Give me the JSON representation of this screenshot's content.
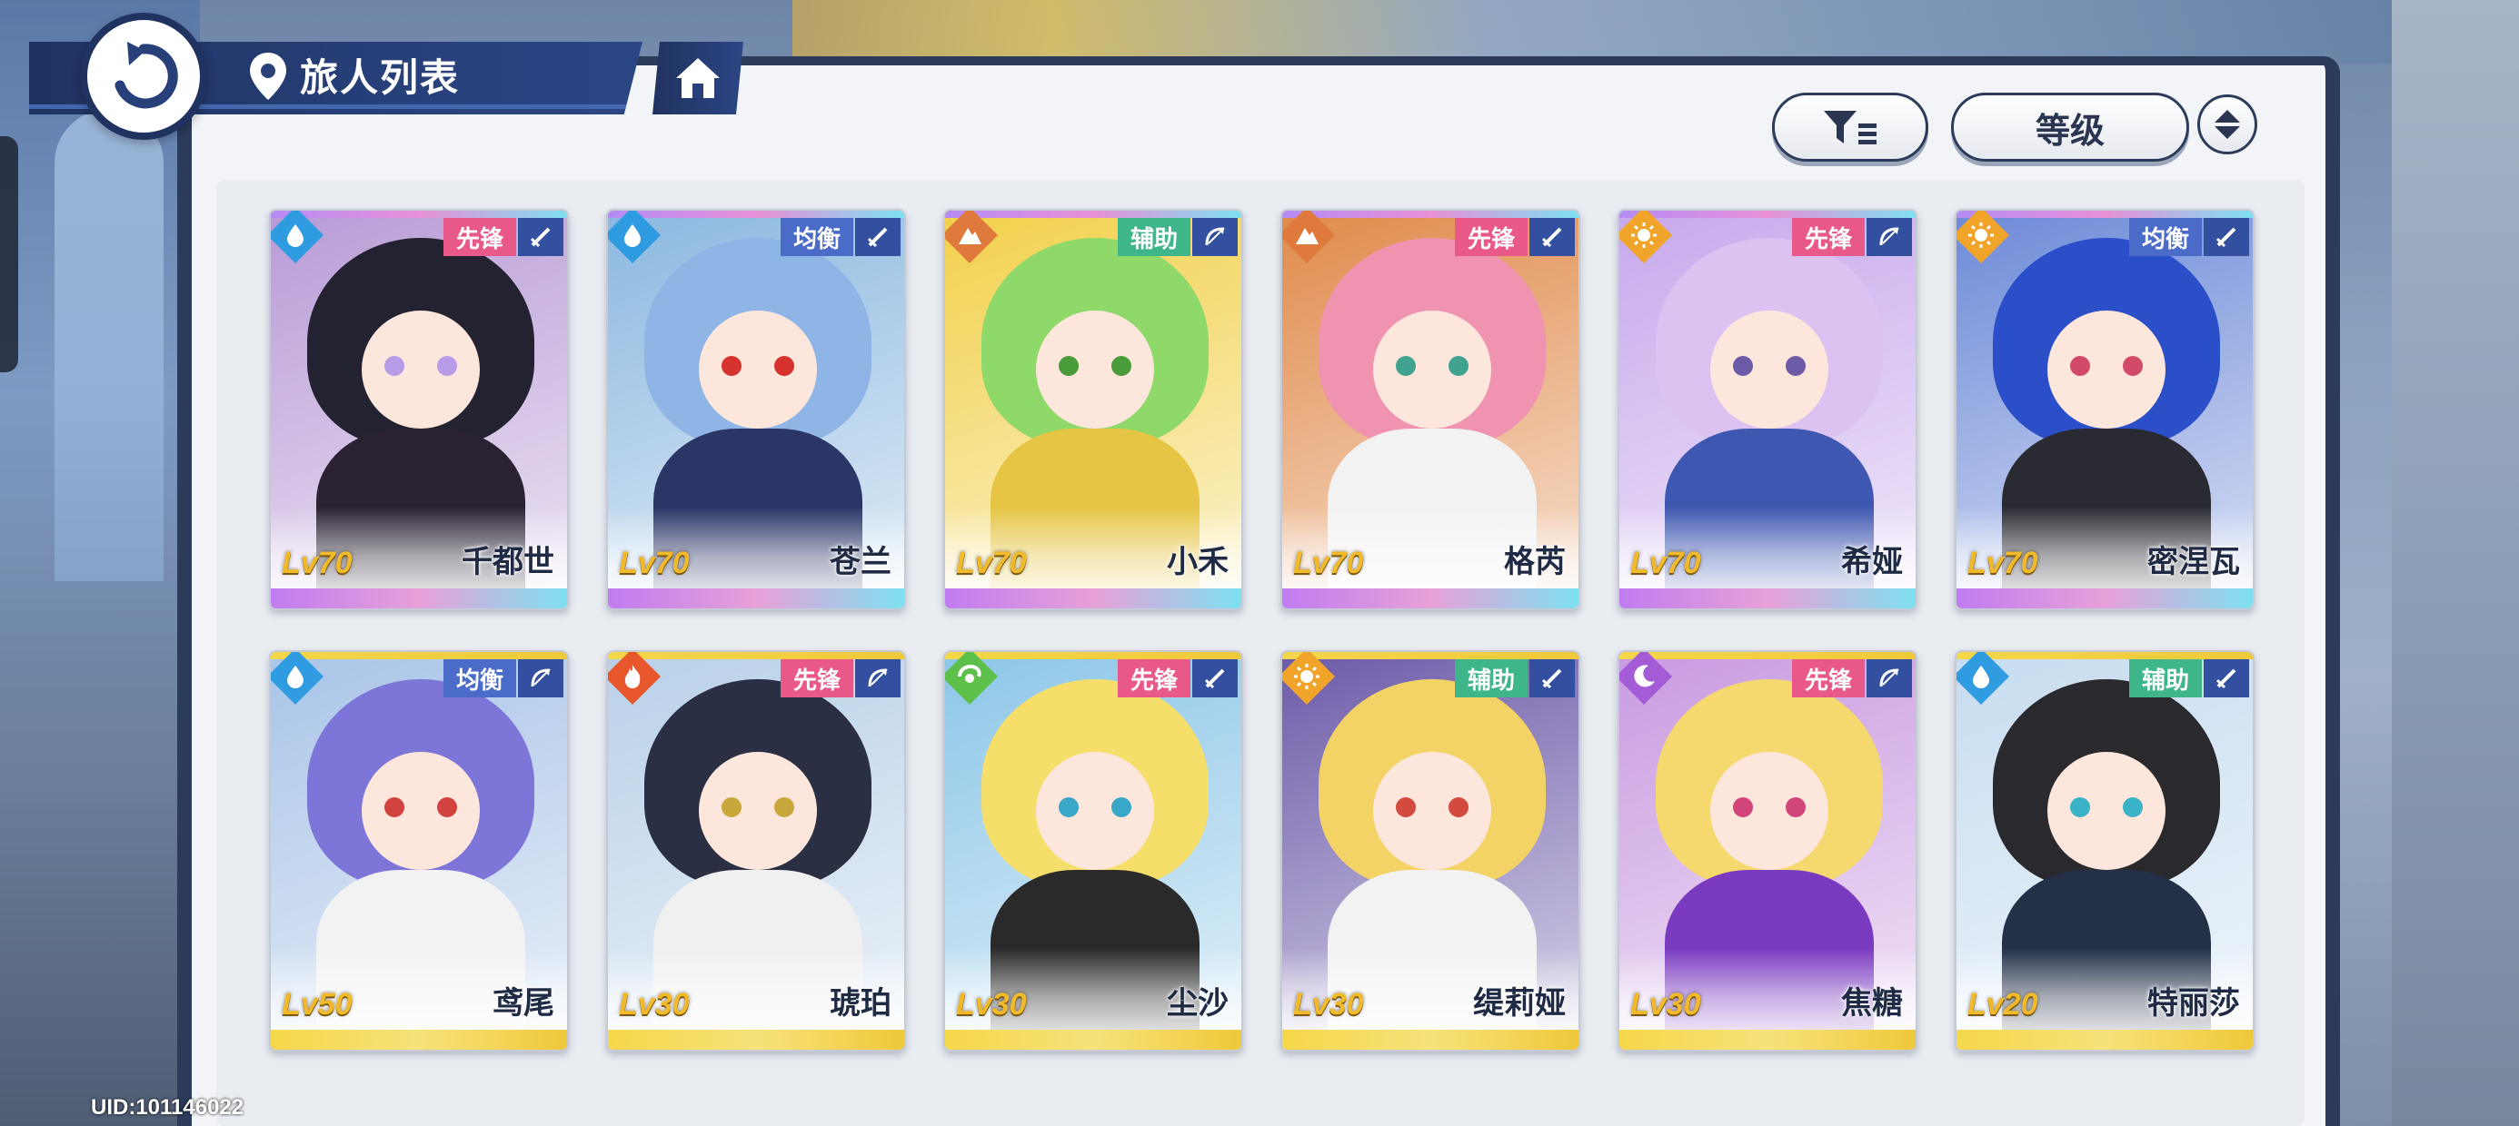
{
  "header": {
    "title": "旅人列表"
  },
  "sort": {
    "label": "等级"
  },
  "footer": {
    "uid": "UID:101146022"
  },
  "colors": {
    "water": "#2f9be0",
    "fire": "#e8572c",
    "rock": "#e07a3c",
    "sun": "#f0a42a",
    "wind": "#5cc04a",
    "moon": "#a35cd6",
    "role_vanguard": "#e8598a",
    "role_balance": "#4b6bc8",
    "role_support": "#3fb58a",
    "rare_top": "#b58cf5",
    "rare_bottom": "#7de0f0",
    "gold_top": "#f5d74a",
    "gold_bottom": "#f0c93a"
  },
  "characters": [
    {
      "name": "千都世",
      "level": "Lv70",
      "element": "water",
      "element_icon": "droplet-icon",
      "role": "先锋",
      "role_type": "vanguard",
      "weapon_icon": "sword-icon",
      "rarity": "rainbow",
      "hair": "#222230",
      "eye": "#b69be8",
      "outfit": "#2a2233",
      "bg": "#b89ad6"
    },
    {
      "name": "苍兰",
      "level": "Lv70",
      "element": "water",
      "element_icon": "droplet-icon",
      "role": "均衡",
      "role_type": "balance",
      "weapon_icon": "sword-icon",
      "rarity": "rainbow",
      "hair": "#8fb4e6",
      "eye": "#d6322e",
      "outfit": "#2b3566",
      "bg": "#8bb8e0"
    },
    {
      "name": "小禾",
      "level": "Lv70",
      "element": "rock",
      "element_icon": "mountain-icon",
      "role": "辅助",
      "role_type": "support",
      "weapon_icon": "bow-icon",
      "rarity": "rainbow",
      "hair": "#8fd86a",
      "eye": "#4a9b3a",
      "outfit": "#e6c545",
      "bg": "#f2d04a"
    },
    {
      "name": "格芮",
      "level": "Lv70",
      "element": "rock",
      "element_icon": "mountain-icon",
      "role": "先锋",
      "role_type": "vanguard",
      "weapon_icon": "sword-icon",
      "rarity": "rainbow",
      "hair": "#f093b0",
      "eye": "#3fa390",
      "outfit": "#f2f2f2",
      "bg": "#e08a4a"
    },
    {
      "name": "希娅",
      "level": "Lv70",
      "element": "sun",
      "element_icon": "sun-icon",
      "role": "先锋",
      "role_type": "vanguard",
      "weapon_icon": "bow-icon",
      "rarity": "rainbow",
      "hair": "#dcc2f0",
      "eye": "#6b5aa8",
      "outfit": "#3e57b0",
      "bg": "#c7a8ec"
    },
    {
      "name": "密涅瓦",
      "level": "Lv70",
      "element": "sun",
      "element_icon": "sun-icon",
      "role": "均衡",
      "role_type": "balance",
      "weapon_icon": "sword-icon",
      "rarity": "rainbow",
      "hair": "#2b4fc8",
      "eye": "#d14a6a",
      "outfit": "#2a2a33",
      "bg": "#6d8ad8"
    },
    {
      "name": "鸢尾",
      "level": "Lv50",
      "element": "water",
      "element_icon": "droplet-icon",
      "role": "均衡",
      "role_type": "balance",
      "weapon_icon": "bow-icon",
      "rarity": "gold",
      "hair": "#7d76d8",
      "eye": "#d2423e",
      "outfit": "#f2f2f2",
      "bg": "#a9c4e8"
    },
    {
      "name": "琥珀",
      "level": "Lv30",
      "element": "fire",
      "element_icon": "flame-icon",
      "role": "先锋",
      "role_type": "vanguard",
      "weapon_icon": "bow-icon",
      "rarity": "gold",
      "hair": "#2a2f44",
      "eye": "#c8a83a",
      "outfit": "#f0f0f0",
      "bg": "#b8d0e8"
    },
    {
      "name": "尘沙",
      "level": "Lv30",
      "element": "wind",
      "element_icon": "swirl-icon",
      "role": "先锋",
      "role_type": "vanguard",
      "weapon_icon": "sword-icon",
      "rarity": "gold",
      "hair": "#f5df6a",
      "eye": "#39a8c8",
      "outfit": "#2a2a2a",
      "bg": "#8cc6e8"
    },
    {
      "name": "缇莉娅",
      "level": "Lv30",
      "element": "sun",
      "element_icon": "sun-icon",
      "role": "辅助",
      "role_type": "support",
      "weapon_icon": "sword-icon",
      "rarity": "gold",
      "hair": "#f3d266",
      "eye": "#d34a3e",
      "outfit": "#f2f2f2",
      "bg": "#6c5aa8"
    },
    {
      "name": "焦糖",
      "level": "Lv30",
      "element": "moon",
      "element_icon": "moon-icon",
      "role": "先锋",
      "role_type": "vanguard",
      "weapon_icon": "bow-icon",
      "rarity": "gold",
      "hair": "#f5d86e",
      "eye": "#d1457a",
      "outfit": "#7a3ac0",
      "bg": "#c99ae0"
    },
    {
      "name": "特丽莎",
      "level": "Lv20",
      "element": "water",
      "element_icon": "droplet-icon",
      "role": "辅助",
      "role_type": "support",
      "weapon_icon": "sword-icon",
      "rarity": "gold",
      "hair": "#2a2a2e",
      "eye": "#3ab2c8",
      "outfit": "#233048",
      "bg": "#c6dcf0"
    }
  ]
}
